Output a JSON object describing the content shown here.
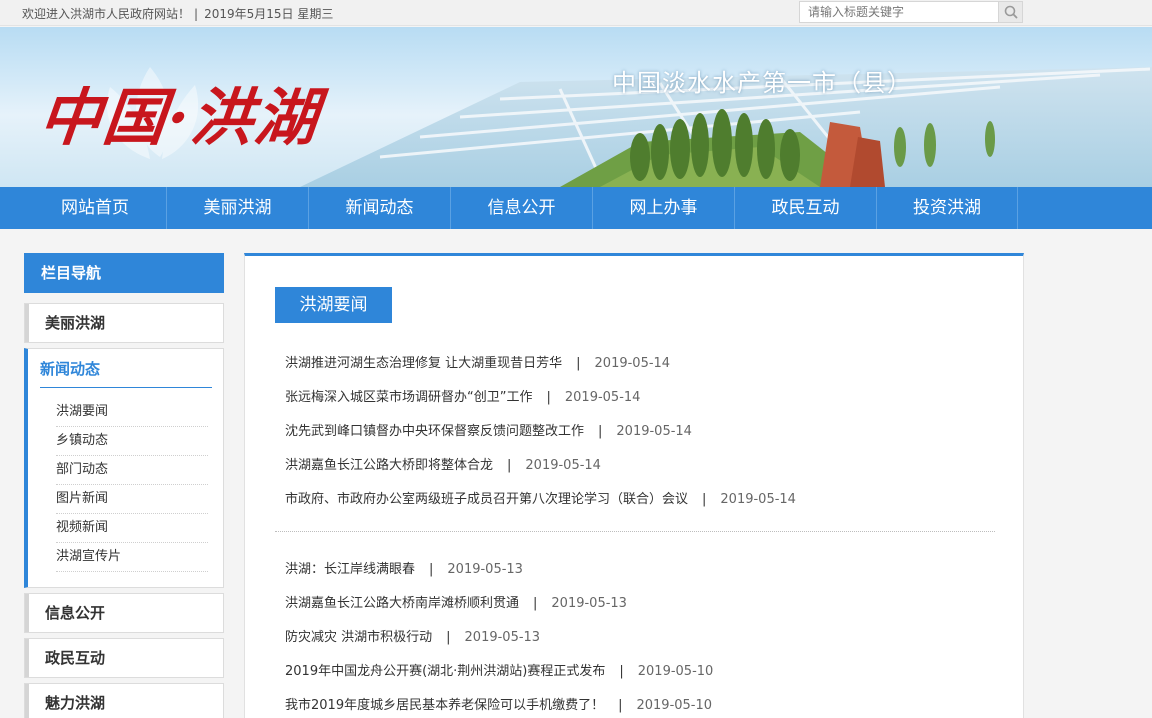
{
  "topbar": {
    "welcome": "欢迎进入洪湖市人民政府网站！",
    "separator": "|",
    "date": "2019年5月15日 星期三",
    "search_placeholder": "请输入标题关键字"
  },
  "banner": {
    "logo_text": "中国·洪湖",
    "slogan": "中国淡水水产第一市（县）"
  },
  "nav": {
    "items": [
      "网站首页",
      "美丽洪湖",
      "新闻动态",
      "信息公开",
      "网上办事",
      "政民互动",
      "投资洪湖"
    ]
  },
  "sidebar": {
    "title": "栏目导航",
    "cat_beautiful": "美丽洪湖",
    "active": {
      "title": "新闻动态",
      "items": [
        "洪湖要闻",
        "乡镇动态",
        "部门动态",
        "图片新闻",
        "视频新闻",
        "洪湖宣传片"
      ]
    },
    "cat_info": "信息公开",
    "cat_interact": "政民互动",
    "cat_charm": "魅力洪湖"
  },
  "content": {
    "section_title": "洪湖要闻",
    "sep": "|",
    "group1": [
      {
        "title": "洪湖推进河湖生态治理修复 让大湖重现昔日芳华",
        "date": "2019-05-14"
      },
      {
        "title": "张远梅深入城区菜市场调研督办“创卫”工作",
        "date": "2019-05-14"
      },
      {
        "title": "沈先武到峰口镇督办中央环保督察反馈问题整改工作",
        "date": "2019-05-14"
      },
      {
        "title": "洪湖嘉鱼长江公路大桥即将整体合龙",
        "date": "2019-05-14"
      },
      {
        "title": "市政府、市政府办公室两级班子成员召开第八次理论学习（联合）会议",
        "date": "2019-05-14"
      }
    ],
    "group2": [
      {
        "title": "洪湖：长江岸线满眼春",
        "date": "2019-05-13"
      },
      {
        "title": "洪湖嘉鱼长江公路大桥南岸滩桥顺利贯通",
        "date": "2019-05-13"
      },
      {
        "title": "防灾减灾 洪湖市积极行动",
        "date": "2019-05-13"
      },
      {
        "title": "2019年中国龙舟公开赛(湖北·荆州洪湖站)赛程正式发布",
        "date": "2019-05-10"
      },
      {
        "title": "我市2019年度城乡居民基本养老保险可以手机缴费了！",
        "date": "2019-05-10"
      }
    ]
  },
  "colors": {
    "accent": "#2f86d9",
    "logo_red": "#c8161d"
  }
}
